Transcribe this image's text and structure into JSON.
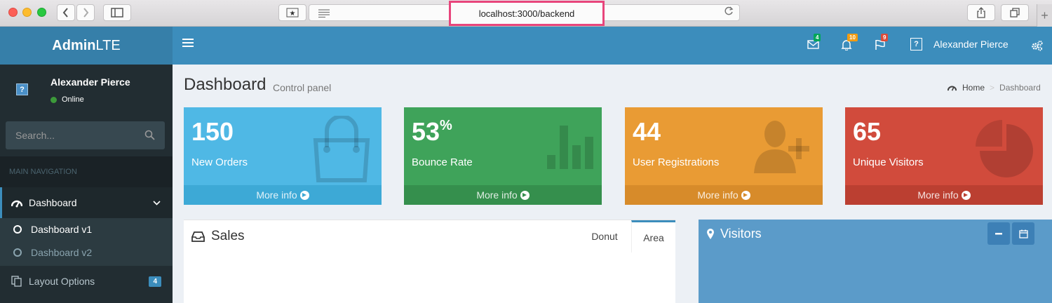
{
  "browser": {
    "url": "localhost:3000/backend"
  },
  "header": {
    "logo_bold": "Admin",
    "logo_light": "LTE",
    "messages_count": "4",
    "notifications_count": "10",
    "tasks_count": "9",
    "user_name": "Alexander Pierce",
    "badge_colors": {
      "messages": "#00a65a",
      "notifications": "#f39c12",
      "tasks": "#dd4b39"
    }
  },
  "sidebar": {
    "user_name": "Alexander Pierce",
    "status": "Online",
    "search_placeholder": "Search...",
    "nav_header": "MAIN NAVIGATION",
    "items": [
      {
        "label": "Dashboard",
        "icon": "dashboard-icon",
        "active": true
      },
      {
        "label": "Dashboard v1",
        "icon": "circle-icon",
        "active": true
      },
      {
        "label": "Dashboard v2",
        "icon": "circle-icon",
        "active": false
      },
      {
        "label": "Layout Options",
        "icon": "files-icon",
        "badge": "4"
      }
    ]
  },
  "content": {
    "title": "Dashboard",
    "subtitle": "Control panel",
    "breadcrumb": [
      "Home",
      "Dashboard"
    ],
    "boxes": [
      {
        "value": "150",
        "suffix": "",
        "label": "New Orders",
        "footer": "More info",
        "color": "#00c0ef",
        "icon": "shopping-bag-icon"
      },
      {
        "value": "53",
        "suffix": "%",
        "label": "Bounce Rate",
        "footer": "More info",
        "color": "#00a65a",
        "icon": "bar-chart-icon"
      },
      {
        "value": "44",
        "suffix": "",
        "label": "User Registrations",
        "footer": "More info",
        "color": "#f39c12",
        "icon": "person-add-icon"
      },
      {
        "value": "65",
        "suffix": "",
        "label": "Unique Visitors",
        "footer": "More info",
        "color": "#dd4b39",
        "icon": "pie-chart-icon"
      }
    ],
    "sales": {
      "title": "Sales",
      "tabs": [
        "Donut",
        "Area"
      ],
      "active_tab": "Area"
    },
    "visitors": {
      "title": "Visitors"
    }
  }
}
